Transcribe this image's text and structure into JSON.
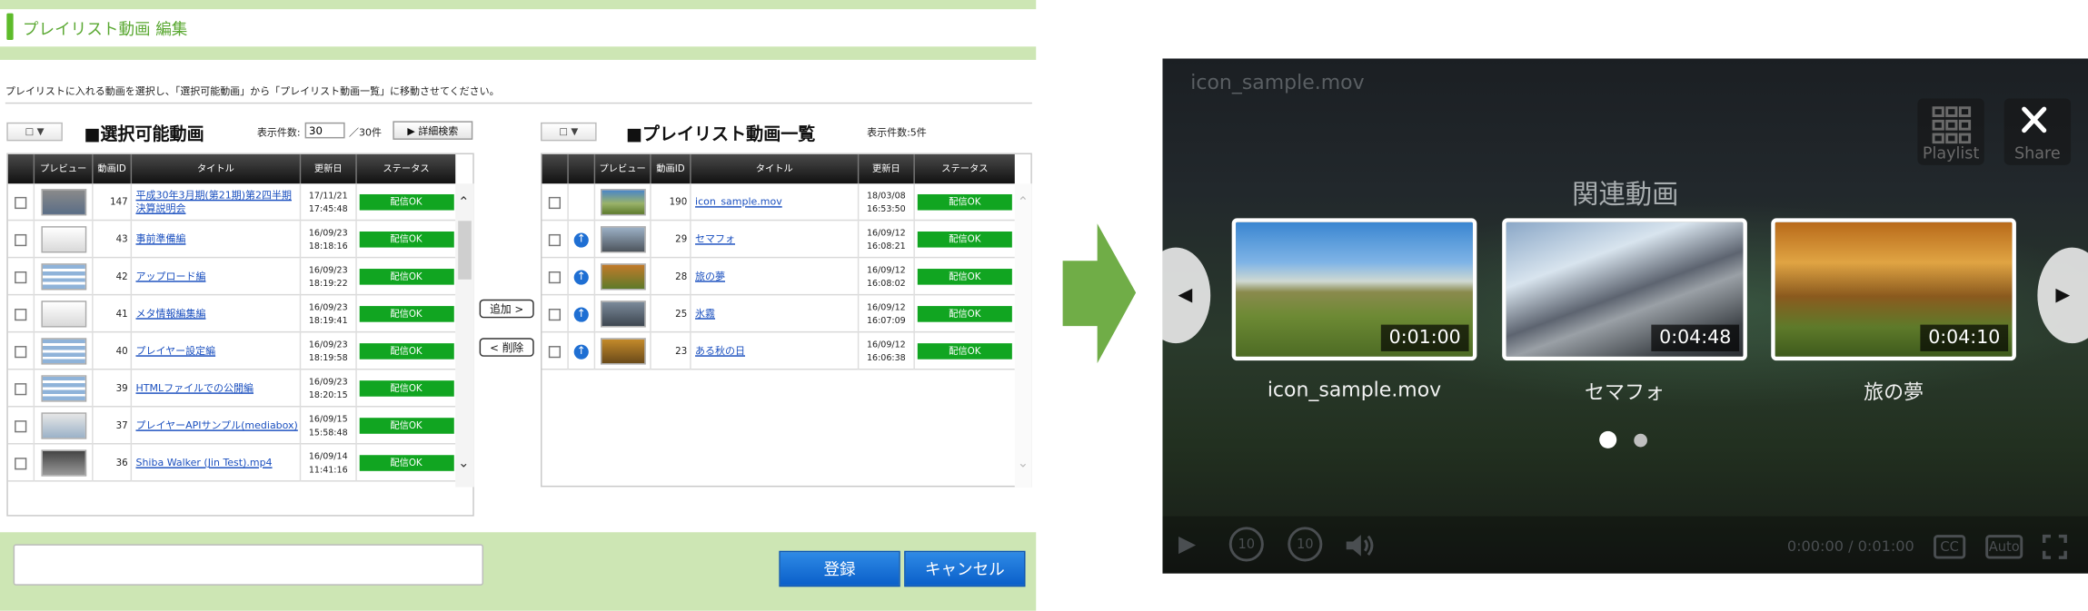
{
  "editor": {
    "page_title": "プレイリスト動画 編集",
    "instruction": "プレイリストに入れる動画を選択し、「選択可能動画」から「プレイリスト動画一覧」に移動させてください。",
    "select_btn": "□ ▼",
    "mid_buttons": {
      "add": "追加 >",
      "remove": "< 削除"
    },
    "footer": {
      "register": "登録",
      "cancel": "キャンセル"
    }
  },
  "available": {
    "title": "■選択可能動画",
    "count_label": "表示件数:",
    "count_value": "30",
    "count_total": "／30件",
    "advanced_search": "▶ 詳細検索",
    "columns": [
      "プレビュー",
      "動画ID",
      "タイトル",
      "更新日",
      "ステータス"
    ],
    "rows": [
      {
        "id": "147",
        "title": "平成30年3月期(第21期)第2四半期決算説明会",
        "date": "17/11/21",
        "time": "17:45:48",
        "status": "配信OK"
      },
      {
        "id": "43",
        "title": "事前準備編",
        "date": "16/09/23",
        "time": "18:18:16",
        "status": "配信OK"
      },
      {
        "id": "42",
        "title": "アップロード編",
        "date": "16/09/23",
        "time": "18:19:22",
        "status": "配信OK"
      },
      {
        "id": "41",
        "title": "メタ情報編集編",
        "date": "16/09/23",
        "time": "18:19:41",
        "status": "配信OK"
      },
      {
        "id": "40",
        "title": "プレイヤー設定編",
        "date": "16/09/23",
        "time": "18:19:58",
        "status": "配信OK"
      },
      {
        "id": "39",
        "title": "HTMLファイルでの公開編",
        "date": "16/09/23",
        "time": "18:20:15",
        "status": "配信OK"
      },
      {
        "id": "37",
        "title": "プレイヤーAPIサンプル(mediabox)",
        "date": "16/09/15",
        "time": "15:58:48",
        "status": "配信OK"
      },
      {
        "id": "36",
        "title": "Shiba Walker (Jin Test).mp4",
        "date": "16/09/14",
        "time": "11:41:16",
        "status": "配信OK"
      }
    ]
  },
  "playlist": {
    "title": "■プレイリスト動画一覧",
    "count_label": "表示件数:5件",
    "columns": [
      "プレビュー",
      "動画ID",
      "タイトル",
      "更新日",
      "ステータス"
    ],
    "rows": [
      {
        "id": "190",
        "title": "icon_sample.mov",
        "date": "18/03/08",
        "time": "16:53:50",
        "status": "配信OK"
      },
      {
        "id": "29",
        "title": "セマフォ",
        "date": "16/09/12",
        "time": "16:08:21",
        "status": "配信OK"
      },
      {
        "id": "28",
        "title": "旅の夢",
        "date": "16/09/12",
        "time": "16:08:02",
        "status": "配信OK"
      },
      {
        "id": "25",
        "title": "氷霧",
        "date": "16/09/12",
        "time": "16:07:09",
        "status": "配信OK"
      },
      {
        "id": "23",
        "title": "ある秋の日",
        "date": "16/09/12",
        "time": "16:06:38",
        "status": "配信OK"
      }
    ]
  },
  "player": {
    "file_name": "icon_sample.mov",
    "playlist_label": "Playlist",
    "share_label": "Share",
    "related_title": "関連動画",
    "cards": [
      {
        "duration": "0:01:00",
        "title": "icon_sample.mov"
      },
      {
        "duration": "0:04:48",
        "title": "セマフォ"
      },
      {
        "duration": "0:04:10",
        "title": "旅の夢"
      }
    ],
    "time_display": "0:00:00 / 0:01:00",
    "cc_label": "CC",
    "auto_label": "Auto",
    "replay_label": "10",
    "forward_label": "10"
  },
  "colors": {
    "accent_green": "#5dbb2a",
    "band_green": "#cde6b4",
    "status_green": "#11a521",
    "button_blue": "#1a73d9"
  }
}
